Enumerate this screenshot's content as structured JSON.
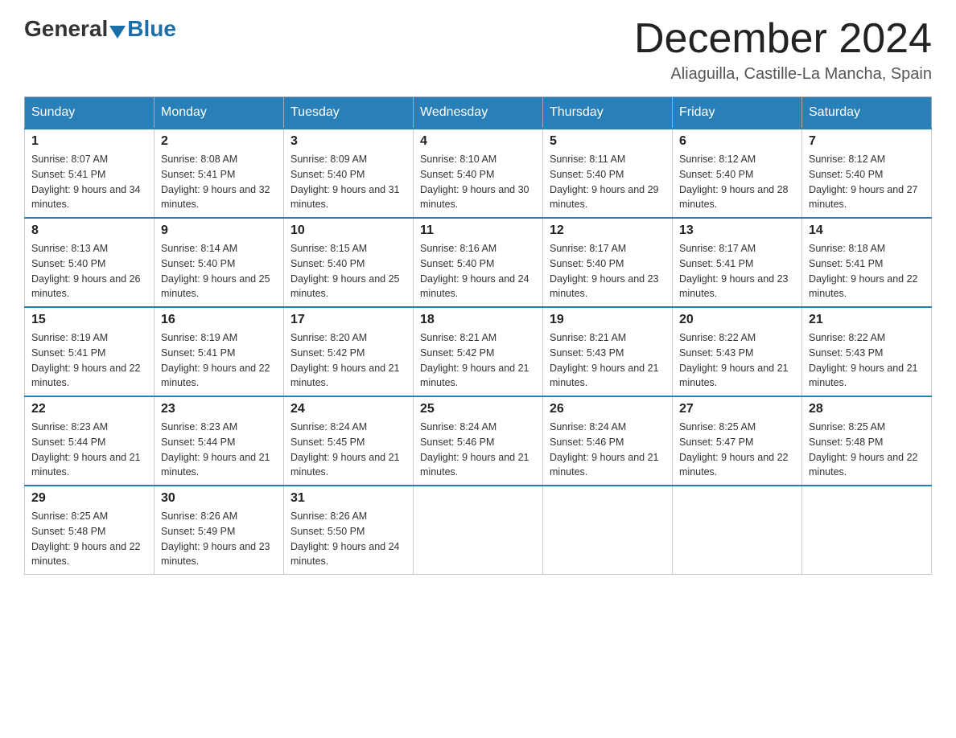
{
  "header": {
    "logo_general": "General",
    "logo_blue": "Blue",
    "month_title": "December 2024",
    "subtitle": "Aliaguilla, Castille-La Mancha, Spain"
  },
  "calendar": {
    "headers": [
      "Sunday",
      "Monday",
      "Tuesday",
      "Wednesday",
      "Thursday",
      "Friday",
      "Saturday"
    ],
    "weeks": [
      [
        {
          "day": "1",
          "sunrise": "Sunrise: 8:07 AM",
          "sunset": "Sunset: 5:41 PM",
          "daylight": "Daylight: 9 hours and 34 minutes."
        },
        {
          "day": "2",
          "sunrise": "Sunrise: 8:08 AM",
          "sunset": "Sunset: 5:41 PM",
          "daylight": "Daylight: 9 hours and 32 minutes."
        },
        {
          "day": "3",
          "sunrise": "Sunrise: 8:09 AM",
          "sunset": "Sunset: 5:40 PM",
          "daylight": "Daylight: 9 hours and 31 minutes."
        },
        {
          "day": "4",
          "sunrise": "Sunrise: 8:10 AM",
          "sunset": "Sunset: 5:40 PM",
          "daylight": "Daylight: 9 hours and 30 minutes."
        },
        {
          "day": "5",
          "sunrise": "Sunrise: 8:11 AM",
          "sunset": "Sunset: 5:40 PM",
          "daylight": "Daylight: 9 hours and 29 minutes."
        },
        {
          "day": "6",
          "sunrise": "Sunrise: 8:12 AM",
          "sunset": "Sunset: 5:40 PM",
          "daylight": "Daylight: 9 hours and 28 minutes."
        },
        {
          "day": "7",
          "sunrise": "Sunrise: 8:12 AM",
          "sunset": "Sunset: 5:40 PM",
          "daylight": "Daylight: 9 hours and 27 minutes."
        }
      ],
      [
        {
          "day": "8",
          "sunrise": "Sunrise: 8:13 AM",
          "sunset": "Sunset: 5:40 PM",
          "daylight": "Daylight: 9 hours and 26 minutes."
        },
        {
          "day": "9",
          "sunrise": "Sunrise: 8:14 AM",
          "sunset": "Sunset: 5:40 PM",
          "daylight": "Daylight: 9 hours and 25 minutes."
        },
        {
          "day": "10",
          "sunrise": "Sunrise: 8:15 AM",
          "sunset": "Sunset: 5:40 PM",
          "daylight": "Daylight: 9 hours and 25 minutes."
        },
        {
          "day": "11",
          "sunrise": "Sunrise: 8:16 AM",
          "sunset": "Sunset: 5:40 PM",
          "daylight": "Daylight: 9 hours and 24 minutes."
        },
        {
          "day": "12",
          "sunrise": "Sunrise: 8:17 AM",
          "sunset": "Sunset: 5:40 PM",
          "daylight": "Daylight: 9 hours and 23 minutes."
        },
        {
          "day": "13",
          "sunrise": "Sunrise: 8:17 AM",
          "sunset": "Sunset: 5:41 PM",
          "daylight": "Daylight: 9 hours and 23 minutes."
        },
        {
          "day": "14",
          "sunrise": "Sunrise: 8:18 AM",
          "sunset": "Sunset: 5:41 PM",
          "daylight": "Daylight: 9 hours and 22 minutes."
        }
      ],
      [
        {
          "day": "15",
          "sunrise": "Sunrise: 8:19 AM",
          "sunset": "Sunset: 5:41 PM",
          "daylight": "Daylight: 9 hours and 22 minutes."
        },
        {
          "day": "16",
          "sunrise": "Sunrise: 8:19 AM",
          "sunset": "Sunset: 5:41 PM",
          "daylight": "Daylight: 9 hours and 22 minutes."
        },
        {
          "day": "17",
          "sunrise": "Sunrise: 8:20 AM",
          "sunset": "Sunset: 5:42 PM",
          "daylight": "Daylight: 9 hours and 21 minutes."
        },
        {
          "day": "18",
          "sunrise": "Sunrise: 8:21 AM",
          "sunset": "Sunset: 5:42 PM",
          "daylight": "Daylight: 9 hours and 21 minutes."
        },
        {
          "day": "19",
          "sunrise": "Sunrise: 8:21 AM",
          "sunset": "Sunset: 5:43 PM",
          "daylight": "Daylight: 9 hours and 21 minutes."
        },
        {
          "day": "20",
          "sunrise": "Sunrise: 8:22 AM",
          "sunset": "Sunset: 5:43 PM",
          "daylight": "Daylight: 9 hours and 21 minutes."
        },
        {
          "day": "21",
          "sunrise": "Sunrise: 8:22 AM",
          "sunset": "Sunset: 5:43 PM",
          "daylight": "Daylight: 9 hours and 21 minutes."
        }
      ],
      [
        {
          "day": "22",
          "sunrise": "Sunrise: 8:23 AM",
          "sunset": "Sunset: 5:44 PM",
          "daylight": "Daylight: 9 hours and 21 minutes."
        },
        {
          "day": "23",
          "sunrise": "Sunrise: 8:23 AM",
          "sunset": "Sunset: 5:44 PM",
          "daylight": "Daylight: 9 hours and 21 minutes."
        },
        {
          "day": "24",
          "sunrise": "Sunrise: 8:24 AM",
          "sunset": "Sunset: 5:45 PM",
          "daylight": "Daylight: 9 hours and 21 minutes."
        },
        {
          "day": "25",
          "sunrise": "Sunrise: 8:24 AM",
          "sunset": "Sunset: 5:46 PM",
          "daylight": "Daylight: 9 hours and 21 minutes."
        },
        {
          "day": "26",
          "sunrise": "Sunrise: 8:24 AM",
          "sunset": "Sunset: 5:46 PM",
          "daylight": "Daylight: 9 hours and 21 minutes."
        },
        {
          "day": "27",
          "sunrise": "Sunrise: 8:25 AM",
          "sunset": "Sunset: 5:47 PM",
          "daylight": "Daylight: 9 hours and 22 minutes."
        },
        {
          "day": "28",
          "sunrise": "Sunrise: 8:25 AM",
          "sunset": "Sunset: 5:48 PM",
          "daylight": "Daylight: 9 hours and 22 minutes."
        }
      ],
      [
        {
          "day": "29",
          "sunrise": "Sunrise: 8:25 AM",
          "sunset": "Sunset: 5:48 PM",
          "daylight": "Daylight: 9 hours and 22 minutes."
        },
        {
          "day": "30",
          "sunrise": "Sunrise: 8:26 AM",
          "sunset": "Sunset: 5:49 PM",
          "daylight": "Daylight: 9 hours and 23 minutes."
        },
        {
          "day": "31",
          "sunrise": "Sunrise: 8:26 AM",
          "sunset": "Sunset: 5:50 PM",
          "daylight": "Daylight: 9 hours and 24 minutes."
        },
        null,
        null,
        null,
        null
      ]
    ]
  }
}
